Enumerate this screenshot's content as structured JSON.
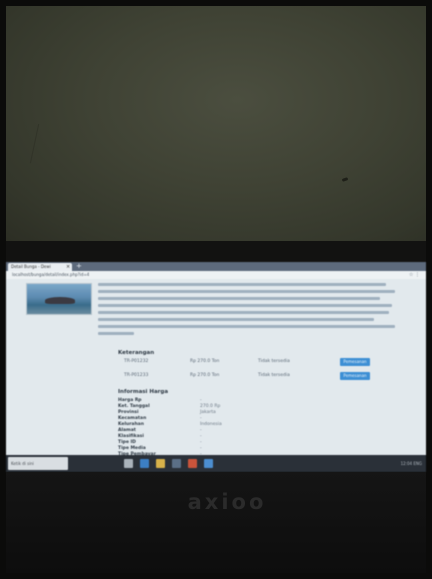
{
  "browser": {
    "tab_title": "Detail Bunga - Dewi",
    "tab_close": "×",
    "new_tab": "+",
    "address": "localhost/bunga/detail/index.php?id=4",
    "address_icons": "☆ ⋮"
  },
  "page": {
    "section_keterangan": "Keterangan",
    "keterangan_rows": [
      {
        "code": "TR-P01232",
        "price": "Rp 270.0 Ton",
        "status": "Tidak tersedia",
        "button": "Pemesanan"
      },
      {
        "code": "TR-P01233",
        "price": "Rp 270.0 Ton",
        "status": "Tidak tersedia",
        "button": "Pemesanan"
      }
    ],
    "section_informasi": "Informasi Harga",
    "info_rows": [
      {
        "label": "Harga Rp",
        "value": "-"
      },
      {
        "label": "Ket. Tanggal",
        "value": "270.0 Rp"
      },
      {
        "label": "Provinsi",
        "value": "Jakarta"
      },
      {
        "label": "Kecamatan",
        "value": "-"
      },
      {
        "label": "Kelurahan",
        "value": "Indonesia"
      },
      {
        "label": "Alamat",
        "value": "-"
      },
      {
        "label": "Klasifikasi",
        "value": "-"
      },
      {
        "label": "Tipe ID",
        "value": "-"
      },
      {
        "label": "Tipe Media",
        "value": "-"
      },
      {
        "label": "Tipe Pembayar",
        "value": "-"
      }
    ]
  },
  "taskbar": {
    "search_placeholder": "Ketik di sini",
    "tray": "12:04 ENG"
  },
  "laptop": {
    "brand": "axioo"
  },
  "colors": {
    "wall": "#3f4234",
    "screen": "#d8e1e6",
    "button": "#3d8fd4",
    "taskbar": "#2a3038"
  }
}
